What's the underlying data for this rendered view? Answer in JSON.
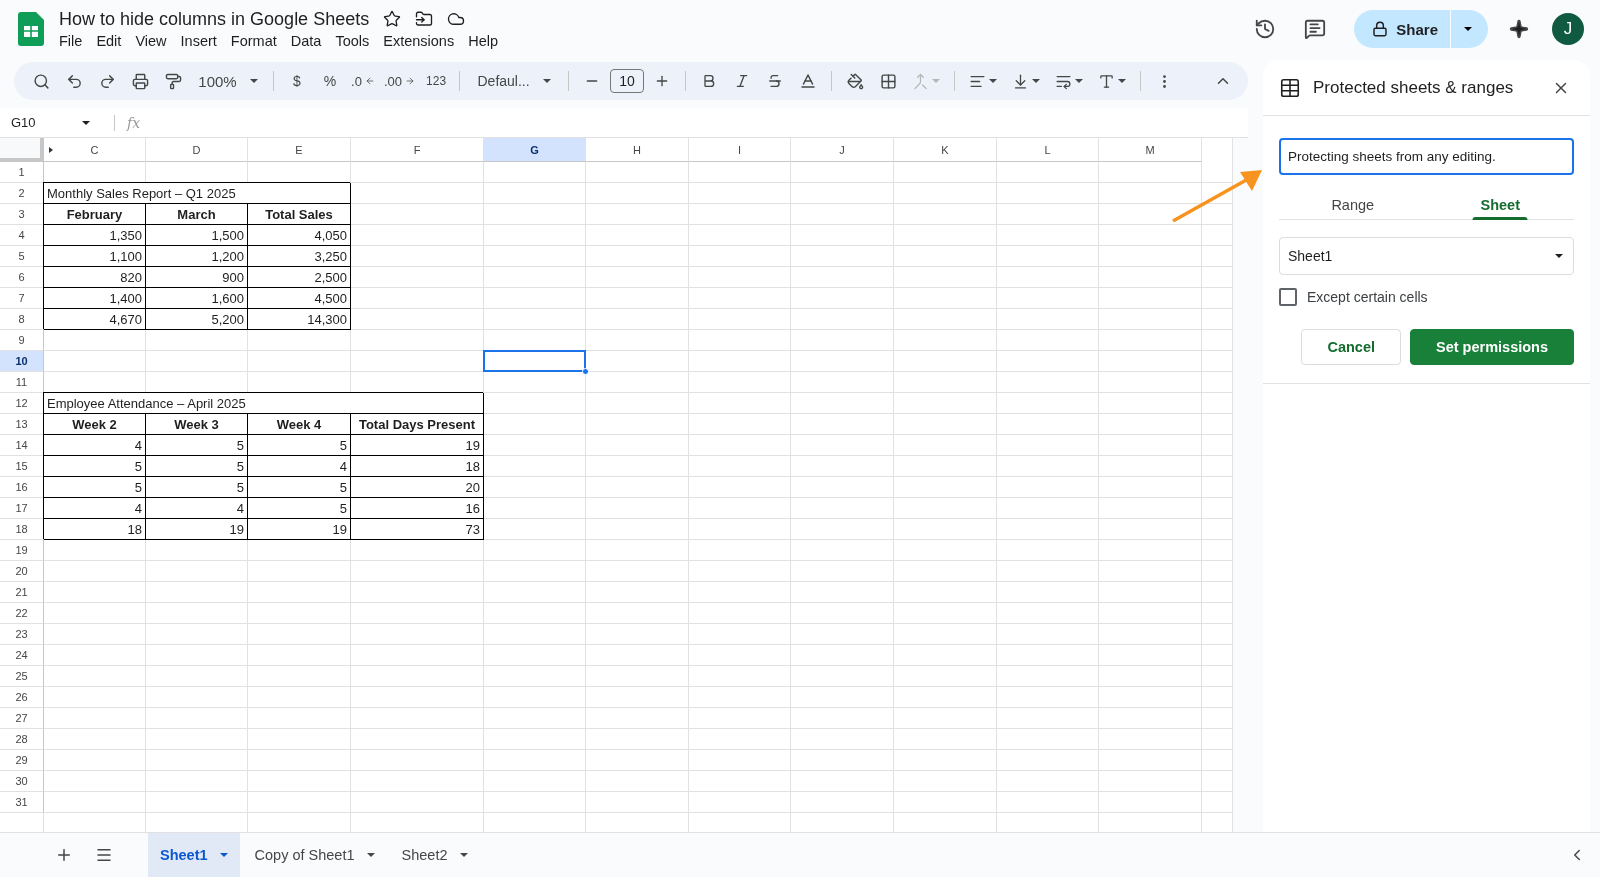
{
  "document": {
    "title": "How to hide columns in Google Sheets"
  },
  "menu": [
    "File",
    "Edit",
    "View",
    "Insert",
    "Format",
    "Data",
    "Tools",
    "Extensions",
    "Help"
  ],
  "share": {
    "label": "Share"
  },
  "avatar": {
    "initial": "J"
  },
  "toolbar": {
    "zoom": "100%",
    "currency": "$",
    "percent": "%",
    "decrease_decimals": ".0",
    "increase_decimals": ".00",
    "number_format": "123",
    "font": "Defaul...",
    "font_size": "10"
  },
  "name_box": "G10",
  "formula_label": "fx",
  "grid": {
    "columns": [
      {
        "label": "C",
        "selected": false
      },
      {
        "label": "D",
        "selected": false
      },
      {
        "label": "E",
        "selected": false
      },
      {
        "label": "F",
        "selected": false
      },
      {
        "label": "G",
        "selected": true
      },
      {
        "label": "H",
        "selected": false
      },
      {
        "label": "I",
        "selected": false
      },
      {
        "label": "J",
        "selected": false
      },
      {
        "label": "K",
        "selected": false
      },
      {
        "label": "L",
        "selected": false
      },
      {
        "label": "M",
        "selected": false
      }
    ],
    "rows": [
      {
        "label": "1",
        "selected": false
      },
      {
        "label": "2",
        "selected": false,
        "cells": [
          {
            "kind": "title",
            "text": "Monthly Sales Report – Q1 2025"
          }
        ]
      },
      {
        "label": "3",
        "selected": false,
        "cells": [
          {
            "kind": "header",
            "text": "February"
          },
          {
            "kind": "header",
            "text": "March"
          },
          {
            "kind": "header",
            "text": "Total Sales"
          }
        ]
      },
      {
        "label": "4",
        "selected": false,
        "cells": [
          {
            "kind": "number",
            "text": "1,350"
          },
          {
            "kind": "number",
            "text": "1,500"
          },
          {
            "kind": "number",
            "text": "4,050"
          }
        ]
      },
      {
        "label": "5",
        "selected": false,
        "cells": [
          {
            "kind": "number",
            "text": "1,100"
          },
          {
            "kind": "number",
            "text": "1,200"
          },
          {
            "kind": "number",
            "text": "3,250"
          }
        ]
      },
      {
        "label": "6",
        "selected": false,
        "cells": [
          {
            "kind": "number",
            "text": "820"
          },
          {
            "kind": "number",
            "text": "900"
          },
          {
            "kind": "number",
            "text": "2,500"
          }
        ]
      },
      {
        "label": "7",
        "selected": false,
        "cells": [
          {
            "kind": "number",
            "text": "1,400"
          },
          {
            "kind": "number",
            "text": "1,600"
          },
          {
            "kind": "number",
            "text": "4,500"
          }
        ]
      },
      {
        "label": "8",
        "selected": false,
        "cells": [
          {
            "kind": "number",
            "text": "4,670"
          },
          {
            "kind": "number",
            "text": "5,200"
          },
          {
            "kind": "number",
            "text": "14,300"
          }
        ]
      },
      {
        "label": "9",
        "selected": false
      },
      {
        "label": "10",
        "selected": true
      },
      {
        "label": "11",
        "selected": false
      },
      {
        "label": "12",
        "selected": false,
        "cells": [
          {
            "kind": "title",
            "text": "Employee Attendance – April 2025"
          }
        ]
      },
      {
        "label": "13",
        "selected": false,
        "cells": [
          {
            "kind": "header",
            "text": "Week 2"
          },
          {
            "kind": "header",
            "text": "Week 3"
          },
          {
            "kind": "header",
            "text": "Week 4"
          },
          {
            "kind": "header",
            "text": "Total Days Present"
          }
        ]
      },
      {
        "label": "14",
        "selected": false,
        "cells": [
          {
            "kind": "number",
            "text": "4"
          },
          {
            "kind": "number",
            "text": "5"
          },
          {
            "kind": "number",
            "text": "5"
          },
          {
            "kind": "number",
            "text": "19"
          }
        ]
      },
      {
        "label": "15",
        "selected": false,
        "cells": [
          {
            "kind": "number",
            "text": "5"
          },
          {
            "kind": "number",
            "text": "5"
          },
          {
            "kind": "number",
            "text": "4"
          },
          {
            "kind": "number",
            "text": "18"
          }
        ]
      },
      {
        "label": "16",
        "selected": false,
        "cells": [
          {
            "kind": "number",
            "text": "5"
          },
          {
            "kind": "number",
            "text": "5"
          },
          {
            "kind": "number",
            "text": "5"
          },
          {
            "kind": "number",
            "text": "20"
          }
        ]
      },
      {
        "label": "17",
        "selected": false,
        "cells": [
          {
            "kind": "number",
            "text": "4"
          },
          {
            "kind": "number",
            "text": "4"
          },
          {
            "kind": "number",
            "text": "5"
          },
          {
            "kind": "number",
            "text": "16"
          }
        ]
      },
      {
        "label": "18",
        "selected": false,
        "cells": [
          {
            "kind": "number",
            "text": "18"
          },
          {
            "kind": "number",
            "text": "19"
          },
          {
            "kind": "number",
            "text": "19"
          },
          {
            "kind": "number",
            "text": "73"
          }
        ]
      },
      {
        "label": "19",
        "selected": false
      },
      {
        "label": "20",
        "selected": false
      },
      {
        "label": "21",
        "selected": false
      },
      {
        "label": "22",
        "selected": false
      },
      {
        "label": "23",
        "selected": false
      },
      {
        "label": "24",
        "selected": false
      },
      {
        "label": "25",
        "selected": false
      },
      {
        "label": "26",
        "selected": false
      },
      {
        "label": "27",
        "selected": false
      },
      {
        "label": "28",
        "selected": false
      },
      {
        "label": "29",
        "selected": false
      },
      {
        "label": "30",
        "selected": false
      },
      {
        "label": "31",
        "selected": false
      }
    ]
  },
  "panel": {
    "title": "Protected sheets & ranges",
    "description": "Protecting sheets from any editing.",
    "tabs": [
      {
        "label": "Range",
        "selected": false
      },
      {
        "label": "Sheet",
        "selected": true
      }
    ],
    "sheet_select": "Sheet1",
    "except_cells": {
      "label": "Except certain cells",
      "checked": false
    },
    "buttons": [
      {
        "kind": "secondary",
        "label": "Cancel"
      },
      {
        "kind": "primary",
        "label": "Set permissions"
      }
    ]
  },
  "sheet_tabs": [
    {
      "label": "Sheet1",
      "selected": true
    },
    {
      "label": "Copy of Sheet1",
      "selected": false
    },
    {
      "label": "Sheet2",
      "selected": false
    }
  ]
}
